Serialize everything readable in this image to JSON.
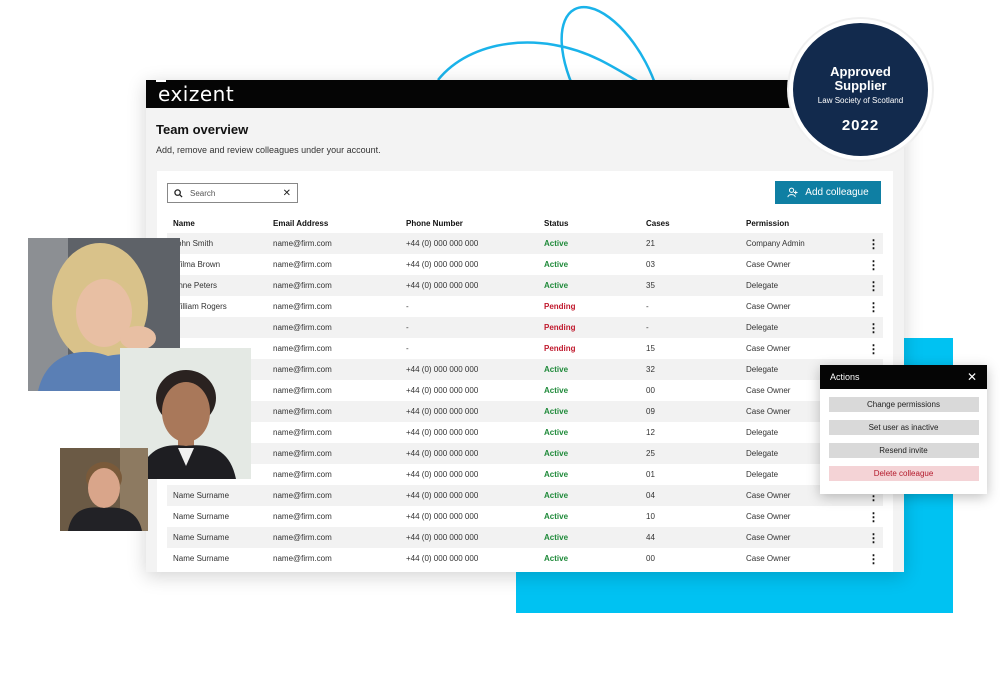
{
  "brand": {
    "logo": "exizent"
  },
  "page": {
    "title": "Team overview",
    "subtitle": "Add, remove and review colleagues under your account."
  },
  "search": {
    "placeholder": "Search"
  },
  "add_button": {
    "label": "Add colleague"
  },
  "table": {
    "headers": [
      "Name",
      "Email Address",
      "Phone Number",
      "Status",
      "Cases",
      "Permission"
    ],
    "rows": [
      {
        "name": "John Smith",
        "email": "name@firm.com",
        "phone": "+44 (0) 000 000 000",
        "status": "Active",
        "cases": "21",
        "permission": "Company Admin"
      },
      {
        "name": "Wilma Brown",
        "email": "name@firm.com",
        "phone": "+44 (0) 000 000 000",
        "status": "Active",
        "cases": "03",
        "permission": "Case Owner"
      },
      {
        "name": "Anne Peters",
        "email": "name@firm.com",
        "phone": "+44 (0) 000 000 000",
        "status": "Active",
        "cases": "35",
        "permission": "Delegate"
      },
      {
        "name": "William Rogers",
        "email": "name@firm.com",
        "phone": "-",
        "status": "Pending",
        "cases": "-",
        "permission": "Case Owner"
      },
      {
        "name": "",
        "email": "name@firm.com",
        "phone": "-",
        "status": "Pending",
        "cases": "-",
        "permission": "Delegate"
      },
      {
        "name": "",
        "email": "name@firm.com",
        "phone": "-",
        "status": "Pending",
        "cases": "15",
        "permission": "Case Owner"
      },
      {
        "name": "",
        "email": "name@firm.com",
        "phone": "+44 (0) 000 000 000",
        "status": "Active",
        "cases": "32",
        "permission": "Delegate"
      },
      {
        "name": "",
        "email": "name@firm.com",
        "phone": "+44 (0) 000 000 000",
        "status": "Active",
        "cases": "00",
        "permission": "Case Owner"
      },
      {
        "name": "",
        "email": "name@firm.com",
        "phone": "+44 (0) 000 000 000",
        "status": "Active",
        "cases": "09",
        "permission": "Case Owner"
      },
      {
        "name": "",
        "email": "name@firm.com",
        "phone": "+44 (0) 000 000 000",
        "status": "Active",
        "cases": "12",
        "permission": "Delegate"
      },
      {
        "name": "",
        "email": "name@firm.com",
        "phone": "+44 (0) 000 000 000",
        "status": "Active",
        "cases": "25",
        "permission": "Delegate"
      },
      {
        "name": "",
        "email": "name@firm.com",
        "phone": "+44 (0) 000 000 000",
        "status": "Active",
        "cases": "01",
        "permission": "Delegate"
      },
      {
        "name": "Name Surname",
        "email": "name@firm.com",
        "phone": "+44 (0) 000 000 000",
        "status": "Active",
        "cases": "04",
        "permission": "Case Owner"
      },
      {
        "name": "Name Surname",
        "email": "name@firm.com",
        "phone": "+44 (0) 000 000 000",
        "status": "Active",
        "cases": "10",
        "permission": "Case Owner"
      },
      {
        "name": "Name Surname",
        "email": "name@firm.com",
        "phone": "+44 (0) 000 000 000",
        "status": "Active",
        "cases": "44",
        "permission": "Case Owner"
      },
      {
        "name": "Name Surname",
        "email": "name@firm.com",
        "phone": "+44 (0) 000 000 000",
        "status": "Active",
        "cases": "00",
        "permission": "Case Owner"
      }
    ]
  },
  "actions_popup": {
    "title": "Actions",
    "items": [
      "Change permissions",
      "Set user as inactive",
      "Resend invite",
      "Delete colleague"
    ]
  },
  "badge": {
    "line1": "Approved",
    "line2": "Supplier",
    "line3": "Law Society of Scotland",
    "year": "2022"
  },
  "colors": {
    "accent": "#0f7fa3",
    "active": "#1f8a3a",
    "pending": "#c0192d",
    "cyan": "#00c2f2",
    "badge_navy": "#122a4d"
  }
}
